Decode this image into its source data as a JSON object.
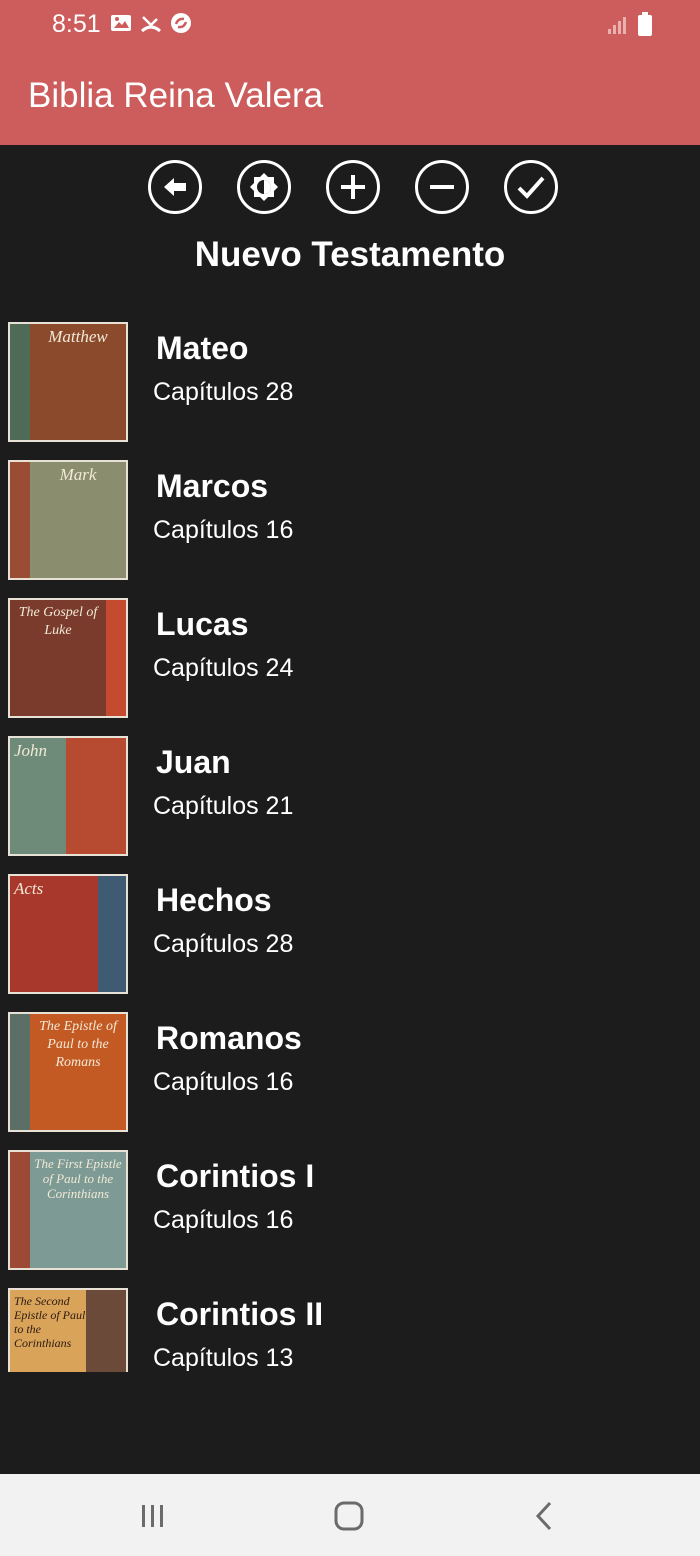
{
  "status_bar": {
    "time": "8:51",
    "icons": [
      "image-icon",
      "missed-call-icon",
      "sync-icon"
    ],
    "right_icons": [
      "signal-icon",
      "battery-icon"
    ]
  },
  "app_bar": {
    "title": "Biblia Reina Valera",
    "color": "#cd5c5c"
  },
  "toolbar": {
    "buttons": [
      {
        "name": "back-button",
        "icon": "arrow-left-icon"
      },
      {
        "name": "brightness-button",
        "icon": "brightness-icon"
      },
      {
        "name": "zoom-in-button",
        "icon": "plus-icon"
      },
      {
        "name": "zoom-out-button",
        "icon": "minus-icon"
      },
      {
        "name": "confirm-button",
        "icon": "check-icon"
      }
    ]
  },
  "section_title": "Nuevo Testamento",
  "books": [
    {
      "name": "Mateo",
      "chapters": "Capítulos 28",
      "cover_title": "Matthew",
      "cover_color": "#8a4a2b",
      "strip_color": "#4f6b57"
    },
    {
      "name": "Marcos",
      "chapters": "Capítulos 16",
      "cover_title": "Mark",
      "cover_color": "#8a8e6e",
      "strip_color": "#9a4c34"
    },
    {
      "name": "Lucas",
      "chapters": "Capítulos 24",
      "cover_title": "The Gospel of Luke",
      "cover_color": "#7b3b2c",
      "strip_color": "#c44a30"
    },
    {
      "name": "Juan",
      "chapters": "Capítulos 21",
      "cover_title": "John",
      "cover_color": "#6e8a78",
      "strip_color": "#b74b32"
    },
    {
      "name": "Hechos",
      "chapters": "Capítulos 28",
      "cover_title": "Acts",
      "cover_color": "#a9382c",
      "strip_color": "#3f5b74"
    },
    {
      "name": "Romanos",
      "chapters": "Capítulos 16",
      "cover_title": "The Epistle of Paul to the Romans",
      "cover_color": "#c45a23",
      "strip_color": "#5c6f66"
    },
    {
      "name": "Corintios I",
      "chapters": "Capítulos 16",
      "cover_title": "The First Epistle of Paul to the Corinthians",
      "cover_color": "#7d9a94",
      "strip_color": "#9c4a35"
    },
    {
      "name": "Corintios II",
      "chapters": "Capítulos 13",
      "cover_title": "The Second Epistle of Paul to the Corinthians",
      "cover_color": "#d9a45a",
      "strip_color": "#6b4a3a"
    }
  ],
  "nav_bar": {
    "buttons": [
      "recents-button",
      "home-button",
      "back-nav-button"
    ]
  }
}
